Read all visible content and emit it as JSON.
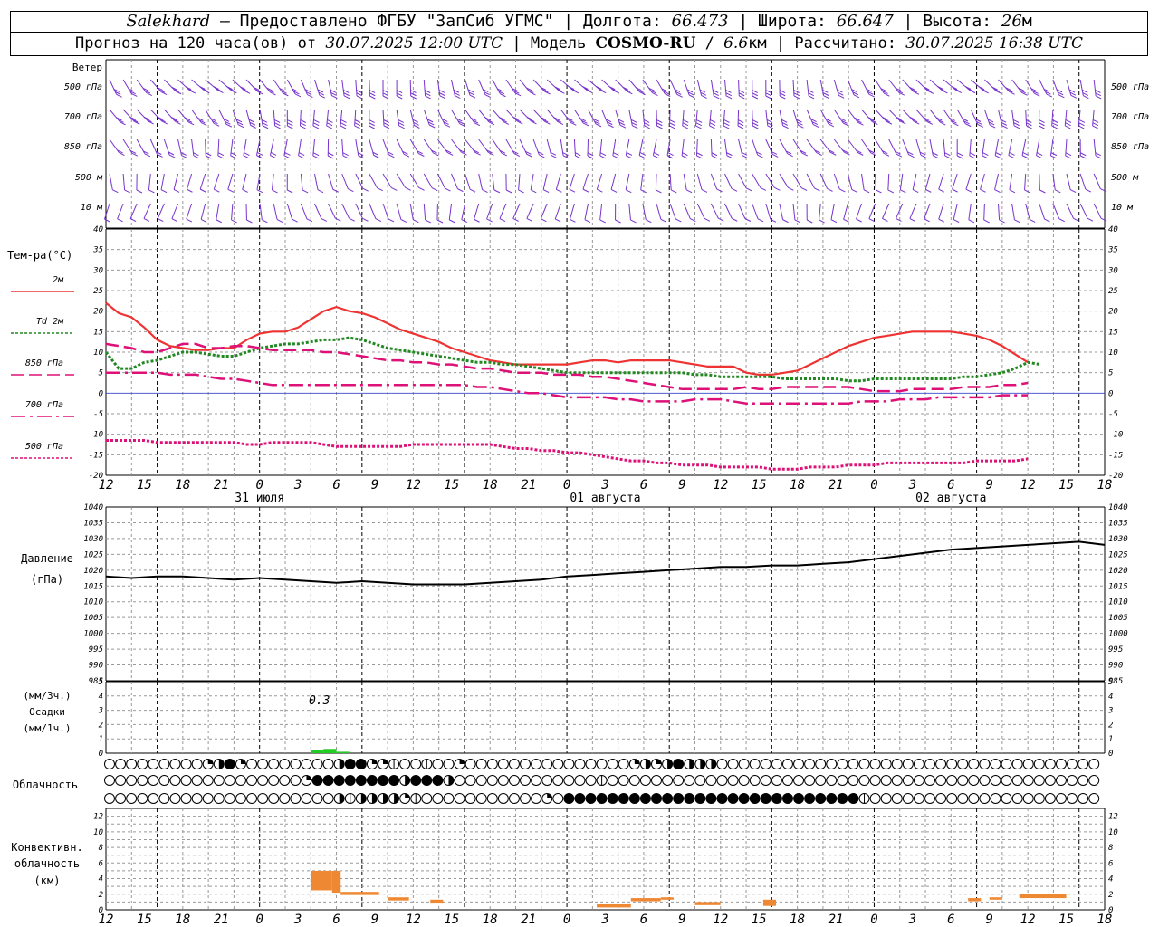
{
  "header": {
    "station": "Salekhard",
    "provided_by": " – Предоставлено ФГБУ \"ЗапСиб УГМС\" | Долгота: ",
    "lon": "66.473",
    "lat_label": " | Широта: ",
    "lat": "66.647",
    "alt_label": " | Высота: ",
    "alt": "26",
    "alt_unit": "м",
    "forecast_label": "Прогноз на 120 часа(ов) от ",
    "init_time": "30.07.2025 12:00 UTC",
    "model_label": "  | Модель ",
    "model": "COSMO-RU",
    "res_sep": " / ",
    "res": "6.6",
    "res_unit": "км",
    "calc_label": " | Рассчитано: ",
    "calc_time": "30.07.2025 16:38 UTC"
  },
  "panels": {
    "wind": {
      "title": "Ветер",
      "levels": [
        "500 гПа",
        "700 гПа",
        "850 гПа",
        "500 м",
        "10 м"
      ],
      "right_levels": [
        "500 гПа",
        "700 гПа",
        "850 гПа",
        "500 м",
        "10 м"
      ]
    },
    "temperature": {
      "title": "Тем-ра(°C)",
      "legend": [
        {
          "label": "2м",
          "color": "#ee3333",
          "dash": "solid"
        },
        {
          "label": "Td  2м",
          "color": "#228822",
          "dash": "dotted"
        },
        {
          "label": "850 гПа",
          "color": "#dd1177",
          "dash": "long-dash"
        },
        {
          "label": "700 гПа",
          "color": "#dd1177",
          "dash": "dash-dot"
        },
        {
          "label": "500 гПа",
          "color": "#dd1177",
          "dash": "dotted"
        }
      ]
    },
    "pressure": {
      "title": "Давление",
      "unit": "(гПа)"
    },
    "precip": {
      "unit1": "(мм/3ч.)",
      "title": "Осадки",
      "unit2": "(мм/1ч.)",
      "annotation": "0.3"
    },
    "cloud": {
      "title": "Облачность"
    },
    "convective": {
      "title1": "Конвективн.",
      "title2": "облачность",
      "unit": "(км)"
    }
  },
  "time_axis": {
    "hour_labels": [
      "12",
      "15",
      "18",
      "21",
      "0",
      "3",
      "6",
      "9",
      "12",
      "15",
      "18",
      "21",
      "0",
      "3",
      "6",
      "9",
      "12",
      "15",
      "18",
      "21",
      "0",
      "3",
      "6",
      "9",
      "12",
      "15",
      "18"
    ],
    "day_labels": [
      "31 июля",
      "01 августа",
      "02 августа"
    ]
  },
  "chart_data": [
    {
      "type": "line",
      "title": "Тем-ра(°C)",
      "x_hours": [
        0,
        3,
        6,
        9,
        12,
        15,
        18,
        21,
        24,
        27,
        30,
        33,
        36,
        39,
        42,
        45,
        48,
        51,
        54,
        57,
        60,
        63,
        66,
        69,
        72,
        75,
        78,
        81,
        84,
        87,
        90,
        93,
        96,
        99,
        102,
        105,
        108,
        111,
        114,
        117,
        120,
        123,
        126,
        129,
        132,
        135,
        138,
        141,
        144,
        147,
        150,
        153,
        156,
        159,
        162,
        165,
        168,
        171,
        174,
        177,
        180,
        183,
        186,
        189,
        192,
        195,
        198,
        201,
        204,
        207,
        210,
        213,
        216,
        219,
        222,
        225,
        228,
        231,
        234
      ],
      "ylim": [
        -20,
        40
      ],
      "series": [
        {
          "name": "2м",
          "color": "#ee3333",
          "values": [
            22,
            19.5,
            18.5,
            16,
            13,
            11.5,
            11,
            10.5,
            10.5,
            11,
            11,
            13,
            14.5,
            15,
            15,
            16,
            18,
            20,
            21,
            20,
            19.5,
            18.5,
            17,
            15.5,
            14.5,
            13.5,
            12.5,
            11,
            10,
            9,
            8,
            7.5,
            7,
            7,
            7,
            7,
            7,
            7.5,
            8,
            8,
            7.5,
            8,
            8,
            8,
            8,
            7.5,
            7,
            6.5,
            6.5,
            6.5,
            5,
            4.5,
            4.5,
            5,
            5.5,
            7,
            8.5,
            10,
            11.5,
            12.5,
            13.5,
            14,
            14.5,
            15,
            15,
            15,
            15,
            14.5,
            14,
            13,
            11.5,
            9.5,
            7.5
          ]
        },
        {
          "name": "Td  2м",
          "color": "#228822",
          "values": [
            10,
            6,
            6,
            7.5,
            8,
            9,
            10,
            10,
            9.5,
            9,
            9,
            10,
            11,
            11.5,
            12,
            12,
            12.5,
            13,
            13,
            13.5,
            13,
            12,
            11,
            10.5,
            10,
            9.5,
            9,
            8.5,
            8,
            7.5,
            7.5,
            7,
            7,
            6.5,
            6,
            5.5,
            5,
            5,
            5,
            5,
            5,
            5,
            5,
            5,
            5,
            5,
            4.5,
            4.5,
            4,
            4,
            4,
            4,
            4,
            3.5,
            3.5,
            3.5,
            3.5,
            3.5,
            3,
            3,
            3.5,
            3.5,
            3.5,
            3.5,
            3.5,
            3.5,
            3.5,
            4,
            4,
            4.5,
            5,
            6,
            7.5,
            7
          ]
        },
        {
          "name": "850 гПа",
          "color": "#dd1177",
          "values": [
            12,
            11.5,
            11,
            10,
            10,
            11,
            12,
            12,
            11,
            11,
            11.5,
            11.5,
            11,
            10.5,
            10.5,
            10.5,
            10.5,
            10,
            10,
            9.5,
            9,
            8.5,
            8,
            8,
            7.5,
            7.5,
            7,
            7,
            6.5,
            6,
            6,
            5.5,
            5,
            5,
            5,
            4.5,
            4.5,
            4.5,
            4,
            4,
            3.5,
            3,
            2.5,
            2,
            1.5,
            1,
            1,
            1,
            1,
            1,
            1.5,
            1,
            1,
            1.5,
            1.5,
            1.5,
            1.5,
            1.5,
            1.5,
            1,
            0.5,
            0.5,
            0.5,
            1,
            1,
            1,
            1,
            1.5,
            1.5,
            1.5,
            2,
            2,
            2.5
          ]
        },
        {
          "name": "700 гПа",
          "color": "#dd1177",
          "values": [
            5,
            5,
            5,
            5,
            5,
            4.5,
            4.5,
            4.5,
            4,
            3.5,
            3.5,
            3,
            2.5,
            2,
            2,
            2,
            2,
            2,
            2,
            2,
            2,
            2,
            2,
            2,
            2,
            2,
            2,
            2,
            2,
            1.5,
            1.5,
            1,
            0.5,
            0,
            0,
            -0.5,
            -1,
            -1,
            -1,
            -1,
            -1.5,
            -1.5,
            -2,
            -2,
            -2,
            -2,
            -1.5,
            -1.5,
            -1.5,
            -2,
            -2.5,
            -2.5,
            -2.5,
            -2.5,
            -2.5,
            -2.5,
            -2.5,
            -2.5,
            -2.5,
            -2,
            -2,
            -2,
            -1.5,
            -1.5,
            -1.5,
            -1,
            -1,
            -1,
            -1,
            -1,
            -0.5,
            -0.5,
            -0.5
          ]
        },
        {
          "name": "500 гПа",
          "color": "#dd1177",
          "values": [
            -11.5,
            -11.5,
            -11.5,
            -11.5,
            -12,
            -12,
            -12,
            -12,
            -12,
            -12,
            -12,
            -12.5,
            -12.5,
            -12,
            -12,
            -12,
            -12,
            -12.5,
            -13,
            -13,
            -13,
            -13,
            -13,
            -13,
            -12.5,
            -12.5,
            -12.5,
            -12.5,
            -12.5,
            -12.5,
            -12.5,
            -13,
            -13.5,
            -13.5,
            -14,
            -14,
            -14.5,
            -14.5,
            -15,
            -15.5,
            -16,
            -16.5,
            -16.5,
            -17,
            -17,
            -17.5,
            -17.5,
            -17.5,
            -18,
            -18,
            -18,
            -18,
            -18.5,
            -18.5,
            -18.5,
            -18,
            -18,
            -18,
            -17.5,
            -17.5,
            -17.5,
            -17,
            -17,
            -17,
            -17,
            -17,
            -17,
            -17,
            -16.5,
            -16.5,
            -16.5,
            -16.5,
            -16
          ]
        }
      ]
    },
    {
      "type": "line",
      "title": "Давление",
      "ylabel": "(гПа)",
      "ylim": [
        985,
        1040
      ],
      "x_hours": [
        0,
        6,
        12,
        18,
        24,
        30,
        36,
        42,
        48,
        54,
        60,
        66,
        72,
        78,
        84,
        90,
        96,
        102,
        108,
        114,
        120,
        126,
        132,
        138,
        144,
        150,
        156,
        162,
        168,
        174,
        180,
        186,
        192,
        198,
        204,
        210,
        216,
        222,
        228,
        234
      ],
      "series": [
        {
          "name": "",
          "color": "#000000",
          "values": [
            1018,
            1017.5,
            1018,
            1018,
            1017.5,
            1017,
            1017.5,
            1017,
            1016.5,
            1016,
            1016.5,
            1016,
            1015.5,
            1015.5,
            1015.5,
            1016,
            1016.5,
            1017,
            1018,
            1018.5,
            1019,
            1019.5,
            1020,
            1020.5,
            1021,
            1021,
            1021.5,
            1021.5,
            1022,
            1022.5,
            1023.5,
            1024.5,
            1025.5,
            1026.5,
            1027,
            1027.5,
            1028,
            1028.5,
            1029,
            1028
          ]
        }
      ]
    },
    {
      "type": "bar",
      "title": "Осадки",
      "ylabel": "(мм/3ч.) (мм/1ч.)",
      "ylim": [
        0,
        5
      ],
      "x_hours": [
        48,
        51,
        54
      ],
      "values": [
        0.2,
        0.3,
        0.1
      ]
    },
    {
      "type": "bar",
      "title": "Конвективн. облачность",
      "ylabel": "(км)",
      "ylim": [
        0,
        13
      ],
      "segments": [
        {
          "x0": 48,
          "x1": 53,
          "base": 2.5,
          "top": 5
        },
        {
          "x0": 53,
          "x1": 55,
          "base": 2.2,
          "top": 5
        },
        {
          "x0": 55,
          "x1": 64,
          "base": 1.9,
          "top": 2.3
        },
        {
          "x0": 66,
          "x1": 71,
          "base": 1.2,
          "top": 1.6
        },
        {
          "x0": 76,
          "x1": 79,
          "base": 0.8,
          "top": 1.3
        },
        {
          "x0": 115,
          "x1": 123,
          "base": 0.3,
          "top": 0.7
        },
        {
          "x0": 123,
          "x1": 130,
          "base": 1.1,
          "top": 1.5
        },
        {
          "x0": 130,
          "x1": 133,
          "base": 1.3,
          "top": 1.6
        },
        {
          "x0": 138,
          "x1": 144,
          "base": 0.6,
          "top": 1.0
        },
        {
          "x0": 154,
          "x1": 157,
          "base": 0.5,
          "top": 1.3
        },
        {
          "x0": 202,
          "x1": 205,
          "base": 1.1,
          "top": 1.5
        },
        {
          "x0": 207,
          "x1": 210,
          "base": 1.3,
          "top": 1.6
        },
        {
          "x0": 214,
          "x1": 225,
          "base": 1.5,
          "top": 2.0
        }
      ]
    }
  ],
  "cloud_rows": [
    "0000000002342000000003442210010020000000000000002323433300000000000000000000000000000000000",
    "0000000000000000002444444443444300000000000001000000000000000000000000000000000000000000000",
    "0000000000000000000003133332100000000000204444444444444444444444444441000000000000000000000"
  ],
  "colors": {
    "t2m": "#ee3333",
    "td": "#228822",
    "upper": "#dd1177",
    "wind": "#7733cc",
    "precip": "#22cc22",
    "conv": "#ee8833",
    "pressure": "#000000",
    "grid": "#999999",
    "zero": "#3344cc"
  }
}
